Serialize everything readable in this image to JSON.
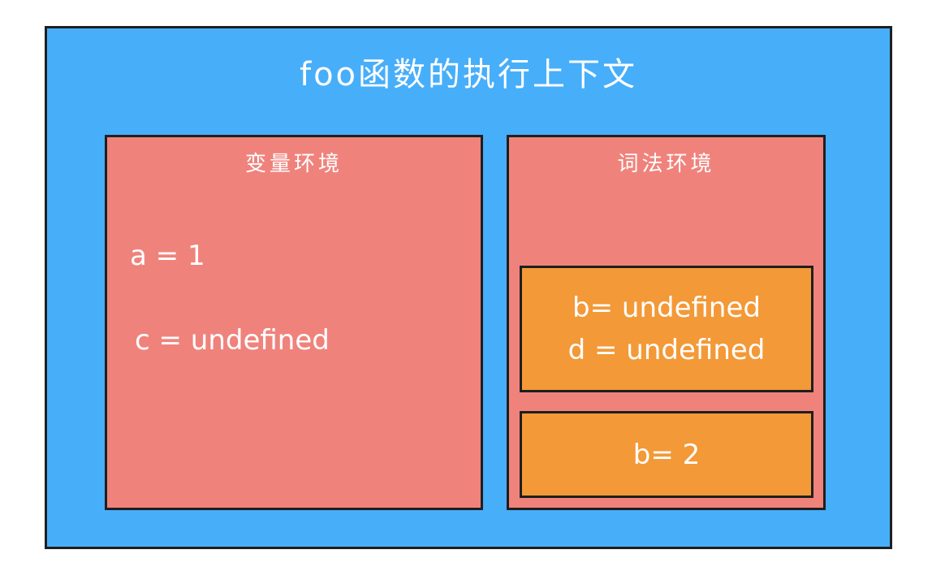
{
  "title": "foo函数的执行上下文",
  "variable_environment": {
    "title": "变量环境",
    "items": [
      "a = 1",
      "c = undefined"
    ]
  },
  "lexical_environment": {
    "title": "词法环境",
    "blocks": [
      {
        "lines": [
          "b= undefined",
          "d = undefined"
        ]
      },
      {
        "lines": [
          "b= 2"
        ]
      }
    ]
  },
  "colors": {
    "context_bg": "#47aefa",
    "environment_bg": "#ef837c",
    "block_bg": "#f39937",
    "text": "#ffffff",
    "border": "#1f1f1f"
  }
}
